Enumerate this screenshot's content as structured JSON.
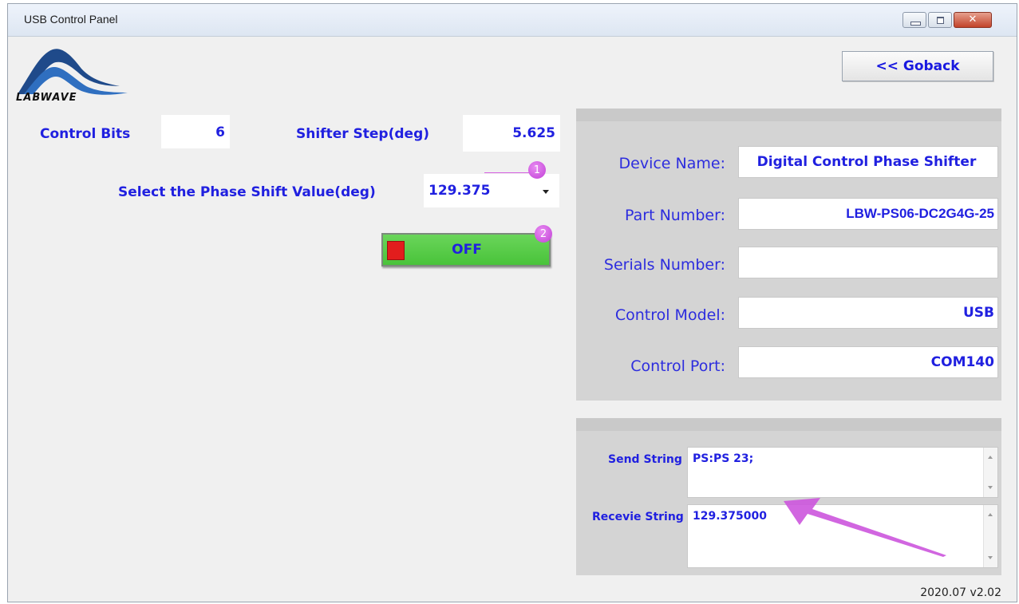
{
  "window": {
    "title": "USB Control Panel",
    "close_glyph": "✕"
  },
  "logo": {
    "text": "LABWAVE",
    "icon": "mountain-wave-logo"
  },
  "goback": {
    "label": "<< Goback"
  },
  "control_bits": {
    "label": "Control Bits",
    "value": "6"
  },
  "shifter_step": {
    "label": "Shifter Step(deg)",
    "value": "5.625"
  },
  "phase_shift": {
    "label": "Select the Phase Shift Value(deg)",
    "value": "129.375"
  },
  "badges": {
    "one": "1",
    "two": "2"
  },
  "toggle": {
    "label": "OFF",
    "led_color": "#e21d1d"
  },
  "device_info": [
    {
      "label": "Device Name:",
      "value": "Digital Control Phase Shifter"
    },
    {
      "label": "Part Number:",
      "value": "LBW-PS06-DC2G4G-25"
    },
    {
      "label": "Serials Number:",
      "value": ""
    },
    {
      "label": "Control Model:",
      "value": "USB"
    },
    {
      "label": "Control Port:",
      "value": "COM140"
    }
  ],
  "comm": {
    "send_label": "Send String",
    "send_value": "PS:PS 23;",
    "receive_label": "Recevie String",
    "receive_value": "129.375000"
  },
  "version": "2020.07 v2.02",
  "colors": {
    "label_blue": "#2020e0",
    "toggle_green": "#49c33a",
    "badge_purple": "#c13fd6"
  }
}
